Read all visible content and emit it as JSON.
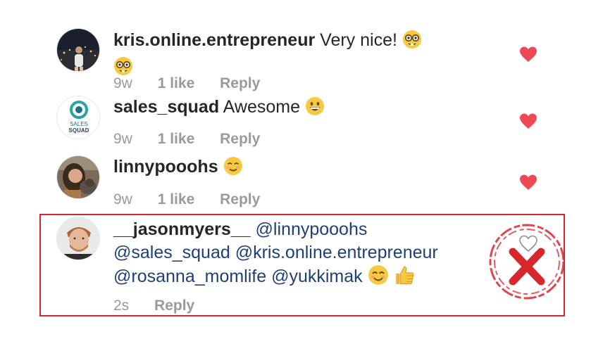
{
  "comments": [
    {
      "username": "kris.online.entrepreneur",
      "text": "Very nice!",
      "time": "9w",
      "likes": "1 like",
      "reply_label": "Reply",
      "liked": true
    },
    {
      "username": "sales_squad",
      "text": "Awesome",
      "avatar_text": "SALES SQUAD",
      "time": "9w",
      "likes": "1 like",
      "reply_label": "Reply",
      "liked": true
    },
    {
      "username": "linnypooohs",
      "text": "",
      "time": "9w",
      "likes": "1 like",
      "reply_label": "Reply",
      "liked": true
    },
    {
      "username": "__jasonmyers__",
      "mentions": [
        "@linnypooohs",
        "@sales_squad",
        "@kris.online.entrepreneur",
        "@rosanna_momlife",
        "@yukkimak"
      ],
      "time": "2s",
      "reply_label": "Reply",
      "liked": false
    }
  ],
  "colors": {
    "heart_liked": "#ed4956",
    "mention": "#1f3f77",
    "meta": "#9a9a9a",
    "highlight": "#d7262c"
  },
  "icons": [
    "nerd-face-emoji",
    "grinning-face-emoji",
    "smiling-face-emoji",
    "smiling-eyes-emoji",
    "thumbs-up-emoji",
    "heart-filled-icon",
    "heart-outline-icon",
    "red-x-stamp-icon"
  ]
}
